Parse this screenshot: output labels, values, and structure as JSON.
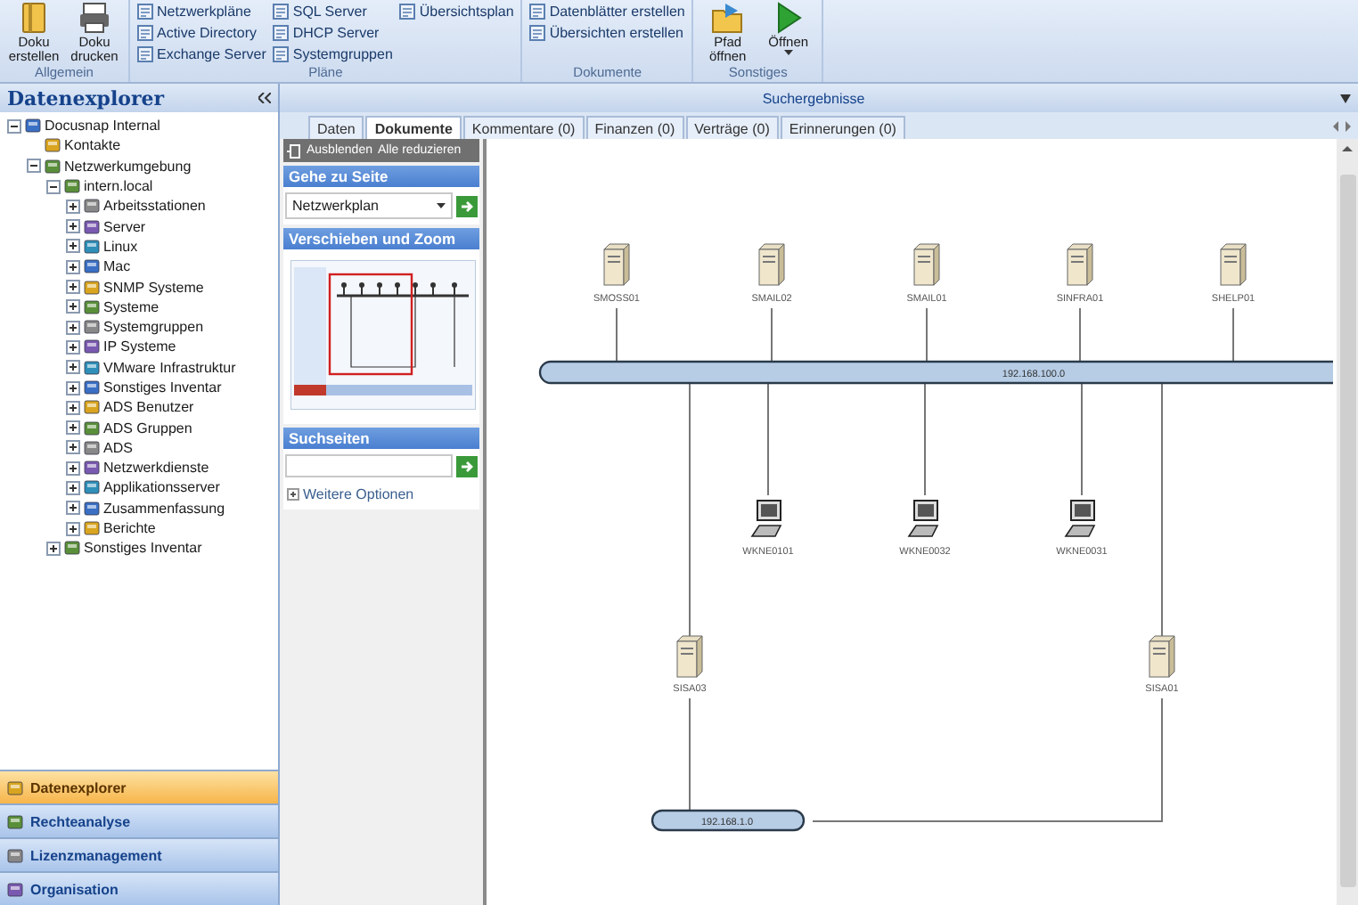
{
  "ribbon": {
    "groups": [
      {
        "label": "Allgemein",
        "kind": "large",
        "buttons": [
          {
            "label": "Doku erstellen",
            "has_menu": false
          },
          {
            "label": "Doku drucken",
            "has_menu": false
          }
        ]
      },
      {
        "label": "Pläne",
        "kind": "small",
        "columns": [
          [
            "Netzwerkpläne",
            "Active Directory",
            "Exchange Server"
          ],
          [
            "SQL Server",
            "DHCP Server",
            "Systemgruppen"
          ],
          [
            "Übersichtsplan"
          ]
        ]
      },
      {
        "label": "Dokumente",
        "kind": "small",
        "columns": [
          [
            "Datenblätter erstellen",
            "Übersichten erstellen"
          ]
        ]
      },
      {
        "label": "Sonstiges",
        "kind": "large",
        "buttons": [
          {
            "label": "Pfad öffnen",
            "has_menu": false
          },
          {
            "label": "Öffnen",
            "has_menu": true
          }
        ]
      }
    ]
  },
  "explorer": {
    "title": "Datenexplorer",
    "tree": [
      {
        "label": "Docusnap Internal",
        "expanded": true,
        "children": [
          {
            "label": "Kontakte"
          },
          {
            "label": "Netzwerkumgebung",
            "expanded": true,
            "children": [
              {
                "label": "intern.local",
                "expanded": true,
                "children": [
                  {
                    "label": "Arbeitsstationen",
                    "expanded": false
                  },
                  {
                    "label": "Server",
                    "expanded": false
                  },
                  {
                    "label": "Linux",
                    "expanded": false
                  },
                  {
                    "label": "Mac",
                    "expanded": false
                  },
                  {
                    "label": "SNMP Systeme",
                    "expanded": false
                  },
                  {
                    "label": "Systeme",
                    "expanded": false
                  },
                  {
                    "label": "Systemgruppen",
                    "expanded": false
                  },
                  {
                    "label": "IP Systeme",
                    "expanded": false
                  },
                  {
                    "label": "VMware Infrastruktur",
                    "expanded": false
                  },
                  {
                    "label": "Sonstiges Inventar",
                    "expanded": false
                  },
                  {
                    "label": "ADS Benutzer",
                    "expanded": false
                  },
                  {
                    "label": "ADS Gruppen",
                    "expanded": false
                  },
                  {
                    "label": "ADS",
                    "expanded": false
                  },
                  {
                    "label": "Netzwerkdienste",
                    "expanded": false
                  },
                  {
                    "label": "Applikationsserver",
                    "expanded": false
                  },
                  {
                    "label": "Zusammenfassung",
                    "expanded": false
                  },
                  {
                    "label": "Berichte",
                    "expanded": false
                  }
                ]
              },
              {
                "label": "Sonstiges Inventar",
                "expanded": false
              }
            ]
          }
        ]
      }
    ],
    "nav": [
      {
        "label": "Datenexplorer",
        "selected": true
      },
      {
        "label": "Rechteanalyse",
        "selected": false
      },
      {
        "label": "Lizenzmanagement",
        "selected": false
      },
      {
        "label": "Organisation",
        "selected": false
      }
    ]
  },
  "results": {
    "title": "Suchergebnisse",
    "tabs": [
      {
        "label": "Daten",
        "selected": false
      },
      {
        "label": "Dokumente",
        "selected": true
      },
      {
        "label": "Kommentare (0)",
        "selected": false
      },
      {
        "label": "Finanzen (0)",
        "selected": false
      },
      {
        "label": "Verträge (0)",
        "selected": false
      },
      {
        "label": "Erinnerungen (0)",
        "selected": false
      }
    ],
    "task_pane": {
      "toolbar": [
        "Ausblenden",
        "Alle reduzieren"
      ],
      "sections": [
        {
          "title": "Gehe zu Seite",
          "kind": "goto",
          "value": "Netzwerkplan"
        },
        {
          "title": "Verschieben und Zoom",
          "kind": "zoom"
        },
        {
          "title": "Suchseiten",
          "kind": "search"
        }
      ],
      "more_options": "Weitere Optionen"
    },
    "diagram": {
      "networks": [
        "192.168.100.0",
        "192.168.1.0"
      ],
      "top_servers": [
        "SMOSS01",
        "SMAIL02",
        "SMAIL01",
        "SINFRA01",
        "SHELP01"
      ],
      "workstations": [
        "WKNE0101",
        "WKNE0032",
        "WKNE0031"
      ],
      "lower_servers": [
        "SISA03",
        "SISA01"
      ]
    }
  }
}
